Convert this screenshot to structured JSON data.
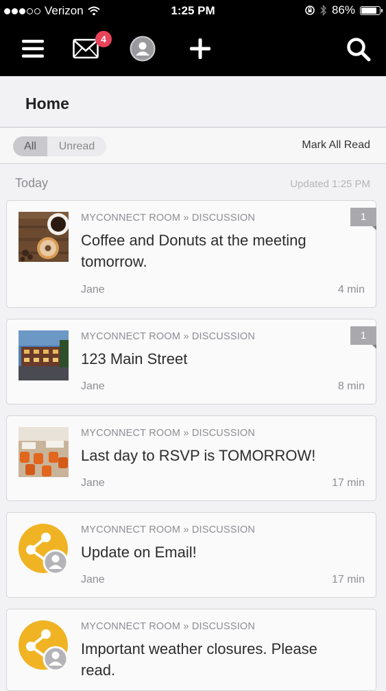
{
  "status_bar": {
    "carrier": "Verizon",
    "time": "1:25 PM",
    "battery_percent": "86%",
    "battery_level": 0.86,
    "signal_bars": 3,
    "signal_total": 5,
    "icons": [
      "wifi-icon",
      "rotation-lock-icon",
      "bluetooth-icon",
      "battery-icon"
    ]
  },
  "nav": {
    "unread_badge": "4",
    "icons": [
      "menu-icon",
      "mail-icon",
      "avatar-icon",
      "plus-icon",
      "search-icon"
    ]
  },
  "header": {
    "title": "Home"
  },
  "filter": {
    "all_label": "All",
    "unread_label": "Unread",
    "selected": "All",
    "mark_all_read": "Mark All Read"
  },
  "section": {
    "label": "Today",
    "updated": "Updated 1:25 PM"
  },
  "feed": [
    {
      "crumb": "MYCONNECT ROOM » DISCUSSION",
      "title": "Coffee and Donuts at the meeting tomorrow.",
      "author": "Jane",
      "age": "4 min",
      "count": "1",
      "thumb": "coffee-donut-photo"
    },
    {
      "crumb": "MYCONNECT ROOM » DISCUSSION",
      "title": "123 Main Street",
      "author": "Jane",
      "age": "8 min",
      "count": "1",
      "thumb": "building-photo"
    },
    {
      "crumb": "MYCONNECT ROOM » DISCUSSION",
      "title": "Last day to RSVP is TOMORROW!",
      "author": "Jane",
      "age": "17 min",
      "count": "",
      "thumb": "restaurant-photo"
    },
    {
      "crumb": "MYCONNECT ROOM » DISCUSSION",
      "title": "Update on Email!",
      "author": "Jane",
      "age": "17 min",
      "count": "",
      "thumb": "share-icon"
    },
    {
      "crumb": "MYCONNECT ROOM » DISCUSSION",
      "title": "Important weather closures. Please read.",
      "author": "",
      "age": "",
      "count": "",
      "thumb": "share-icon"
    }
  ],
  "colors": {
    "badge": "#e8435a",
    "share_icon_bg": "#f0b323",
    "nav_bg": "#000000"
  }
}
